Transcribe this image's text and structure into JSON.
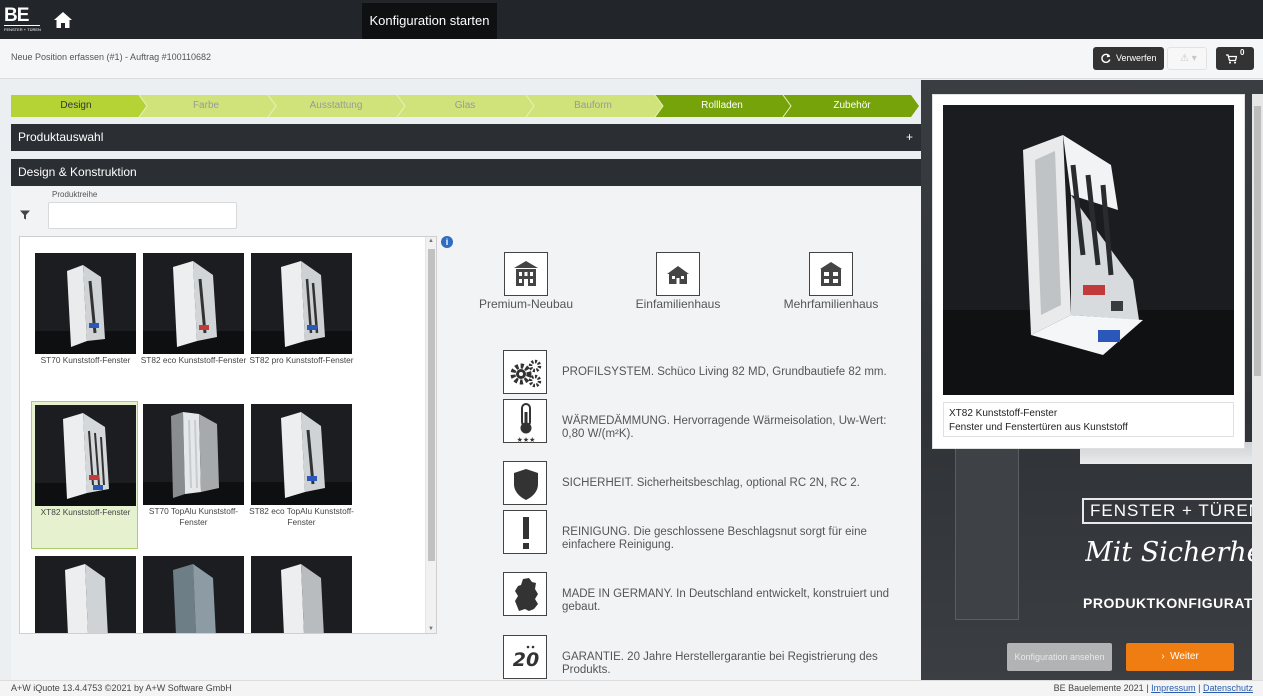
{
  "topbar": {
    "logo_big": "BE",
    "logo_small": "FENSTER + TÜREN",
    "title": "Konfiguration starten"
  },
  "subbar": {
    "breadcrumb": "Neue Position erfassen (#1) - Auftrag #100110682",
    "discard_label": "Verwerfen",
    "warn_label": "⚠ ▾",
    "cart_count": "0"
  },
  "steps": [
    {
      "label": "Design",
      "state": "active"
    },
    {
      "label": "Farbe",
      "state": "inactive"
    },
    {
      "label": "Ausstattung",
      "state": "inactive"
    },
    {
      "label": "Glas",
      "state": "inactive"
    },
    {
      "label": "Bauform",
      "state": "inactive"
    },
    {
      "label": "Rollladen",
      "state": "done"
    },
    {
      "label": "Zubehör",
      "state": "done"
    }
  ],
  "sections": {
    "produktauswahl": "Produktauswahl",
    "produktauswahl_toggle": "+",
    "design": "Design & Konstruktion"
  },
  "filter": {
    "label": "Produktreihe",
    "value": ""
  },
  "products": [
    {
      "name": "ST70 Kunststoff-Fenster",
      "selected": false
    },
    {
      "name": "ST82 eco Kunststoff-Fenster",
      "selected": false
    },
    {
      "name": "ST82 pro Kunststoff-Fenster",
      "selected": false
    },
    {
      "name": "XT82 Kunststoff-Fenster",
      "selected": true
    },
    {
      "name": "ST70 TopAlu Kunststoff-Fenster",
      "selected": false
    },
    {
      "name": "ST82 eco TopAlu Kunststoff-Fenster",
      "selected": false
    },
    {
      "name": "",
      "selected": false
    },
    {
      "name": "",
      "selected": false
    },
    {
      "name": "",
      "selected": false
    }
  ],
  "building_types": [
    "Premium-Neubau",
    "Einfamilienhaus",
    "Mehrfamilienhaus"
  ],
  "features": [
    {
      "icon": "gears-icon",
      "text": "PROFILSYSTEM. Schüco Living 82 MD, Grundbautiefe 82 mm."
    },
    {
      "icon": "thermometer-icon",
      "text": "WÄRMEDÄMMUNG. Hervorragende Wärmeisolation, Uw-Wert: 0,80 W/(m²K)."
    },
    {
      "icon": "shield-icon",
      "text": "SICHERHEIT. Sicherheitsbeschlag, optional RC 2N, RC 2."
    },
    {
      "icon": "exclamation-icon",
      "text": "REINIGUNG. Die geschlossene Beschlagsnut sorgt für eine einfachere Reinigung."
    },
    {
      "icon": "germany-map-icon",
      "text": "MADE IN GERMANY. In Deutschland entwickelt, konstruiert und gebaut."
    },
    {
      "icon": "warranty-20-icon",
      "text": "GARANTIE. 20 Jahre Herstellergarantie bei Registrierung des Produkts."
    }
  ],
  "warranty_badge": "20",
  "preview": {
    "title": "XT82 Kunststoff-Fenster",
    "subtitle": "Fenster und Fenstertüren aus Kunststoff"
  },
  "brand": {
    "fenster": "FENSTER + TÜREN",
    "slogan": "Mit Sicherheit",
    "config": "PRODUKTKONFIGURATOR"
  },
  "actions": {
    "save_label": "Konfiguration ansehen",
    "next_label": "Weiter"
  },
  "footer": {
    "left": "A+W iQuote 13.4.4753 ©2021 by A+W Software GmbH",
    "company": "BE Bauelemente 2021",
    "imprint": "Impressum",
    "privacy": "Datenschutz",
    "sep": "|"
  },
  "colors": {
    "step_active": "#b5d334",
    "step_inactive": "#cfe37a",
    "step_done": "#76a30a",
    "accent_orange": "#ef7d12",
    "dark": "#2b2e33"
  }
}
